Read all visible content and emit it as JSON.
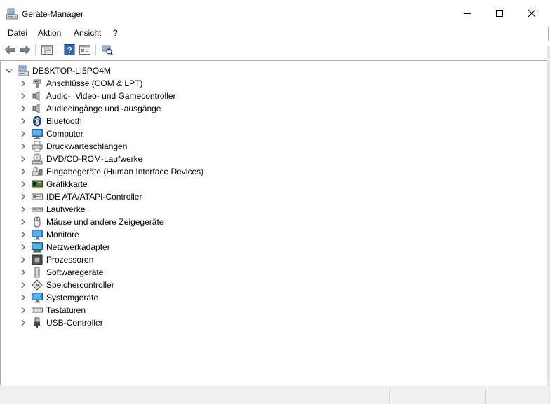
{
  "window": {
    "title": "Geräte-Manager"
  },
  "menu": [
    "Datei",
    "Aktion",
    "Ansicht",
    "?"
  ],
  "toolbar": {
    "buttons": [
      "back-arrow-icon",
      "forward-arrow-icon",
      "show-hide-console-tree-icon",
      "help-icon",
      "properties-icon",
      "scan-hardware-icon"
    ]
  },
  "tree": {
    "root": "DESKTOP-LI5PO4M",
    "items": [
      {
        "label": "Anschlüsse (COM & LPT)",
        "icon": "port-icon"
      },
      {
        "label": "Audio-, Video- und Gamecontroller",
        "icon": "speaker-icon"
      },
      {
        "label": "Audioeingänge und -ausgänge",
        "icon": "speaker-icon"
      },
      {
        "label": "Bluetooth",
        "icon": "bluetooth-icon"
      },
      {
        "label": "Computer",
        "icon": "monitor-icon"
      },
      {
        "label": "Druckwarteschlangen",
        "icon": "printer-icon"
      },
      {
        "label": "DVD/CD-ROM-Laufwerke",
        "icon": "optical-drive-icon"
      },
      {
        "label": "Eingabegeräte (Human Interface Devices)",
        "icon": "hid-icon"
      },
      {
        "label": "Grafikkarte",
        "icon": "graphics-card-icon"
      },
      {
        "label": "IDE ATA/ATAPI-Controller",
        "icon": "ide-controller-icon"
      },
      {
        "label": "Laufwerke",
        "icon": "disk-drive-icon"
      },
      {
        "label": "Mäuse und andere Zeigegeräte",
        "icon": "mouse-icon"
      },
      {
        "label": "Monitore",
        "icon": "monitor-icon"
      },
      {
        "label": "Netzwerkadapter",
        "icon": "network-adapter-icon"
      },
      {
        "label": "Prozessoren",
        "icon": "processor-icon"
      },
      {
        "label": "Softwaregeräte",
        "icon": "software-device-icon"
      },
      {
        "label": "Speichercontroller",
        "icon": "storage-controller-icon"
      },
      {
        "label": "Systemgeräte",
        "icon": "system-device-icon"
      },
      {
        "label": "Tastaturen",
        "icon": "keyboard-icon"
      },
      {
        "label": "USB-Controller",
        "icon": "usb-icon"
      }
    ]
  }
}
